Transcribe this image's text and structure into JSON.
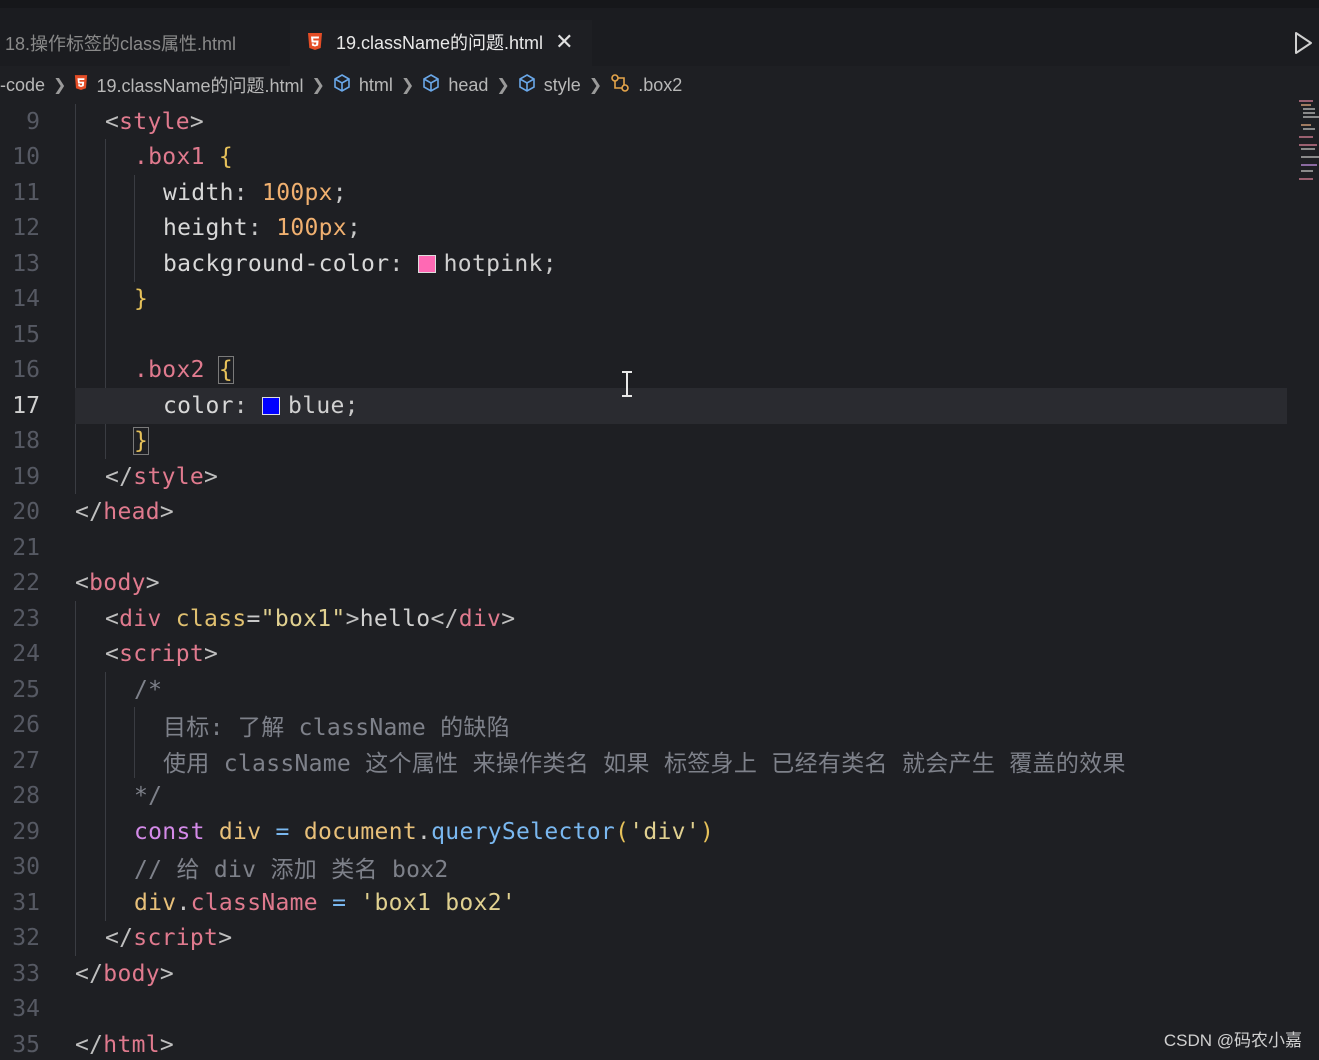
{
  "tabs": [
    {
      "label": "18.操作标签的class属性.html",
      "active": false
    },
    {
      "label": "19.className的问题.html",
      "active": true,
      "close": "✕"
    }
  ],
  "breadcrumb": {
    "root": "-code",
    "file": "19.className的问题.html",
    "items": [
      "html",
      "head",
      "style",
      ".box2"
    ]
  },
  "current_line": 17,
  "lines": [
    {
      "n": "9"
    },
    {
      "n": "10"
    },
    {
      "n": "11"
    },
    {
      "n": "12"
    },
    {
      "n": "13"
    },
    {
      "n": "14"
    },
    {
      "n": "15"
    },
    {
      "n": "16"
    },
    {
      "n": "17"
    },
    {
      "n": "18"
    },
    {
      "n": "19"
    },
    {
      "n": "20"
    },
    {
      "n": "21"
    },
    {
      "n": "22"
    },
    {
      "n": "23"
    },
    {
      "n": "24"
    },
    {
      "n": "25"
    },
    {
      "n": "26"
    },
    {
      "n": "27"
    },
    {
      "n": "28"
    },
    {
      "n": "29"
    },
    {
      "n": "30"
    },
    {
      "n": "31"
    },
    {
      "n": "32"
    },
    {
      "n": "33"
    },
    {
      "n": "34"
    },
    {
      "n": "35"
    }
  ],
  "code": {
    "l9": [
      "<",
      "style",
      ">"
    ],
    "l10": [
      ".box1",
      " {"
    ],
    "l11": [
      "width",
      ": ",
      "100px",
      ";"
    ],
    "l12": [
      "height",
      ": ",
      "100px",
      ";"
    ],
    "l13": [
      "background-color",
      ": ",
      "hotpink",
      ";"
    ],
    "l14": [
      "}"
    ],
    "l16": [
      ".box2",
      " ",
      "{"
    ],
    "l17": [
      "color",
      ": ",
      "blue",
      ";"
    ],
    "l18": [
      "}"
    ],
    "l19": [
      "</",
      "style",
      ">"
    ],
    "l20": [
      "</",
      "head",
      ">"
    ],
    "l22": [
      "<",
      "body",
      ">"
    ],
    "l23": [
      "<",
      "div",
      " ",
      "class",
      "=",
      "\"box1\"",
      ">",
      "hello",
      "</",
      "div",
      ">"
    ],
    "l24": [
      "<",
      "script",
      ">"
    ],
    "l25": [
      "/*"
    ],
    "l26": [
      "目标: 了解 className 的缺陷"
    ],
    "l27": [
      "使用 className 这个属性 来操作类名 如果 标签身上 已经有类名 就会产生 覆盖的效果"
    ],
    "l28": [
      "*/"
    ],
    "l29": [
      "const",
      " ",
      "div",
      " = ",
      "document",
      ".",
      "querySelector",
      "(",
      "'div'",
      ")"
    ],
    "l30": [
      "// 给 div 添加 类名 box2"
    ],
    "l31": [
      "div",
      ".",
      "className",
      " = ",
      "'box1 box2'"
    ],
    "l32": [
      "</",
      "script",
      ">"
    ],
    "l33": [
      "</",
      "body",
      ">"
    ],
    "l35": [
      "</",
      "html",
      ">"
    ]
  },
  "colors": {
    "background": "#1e1f23",
    "hotpink_swatch": "#ff69b4",
    "blue_swatch": "#0000ff",
    "html5_icon": "#e44d26"
  },
  "watermark": "CSDN @码农小嘉"
}
